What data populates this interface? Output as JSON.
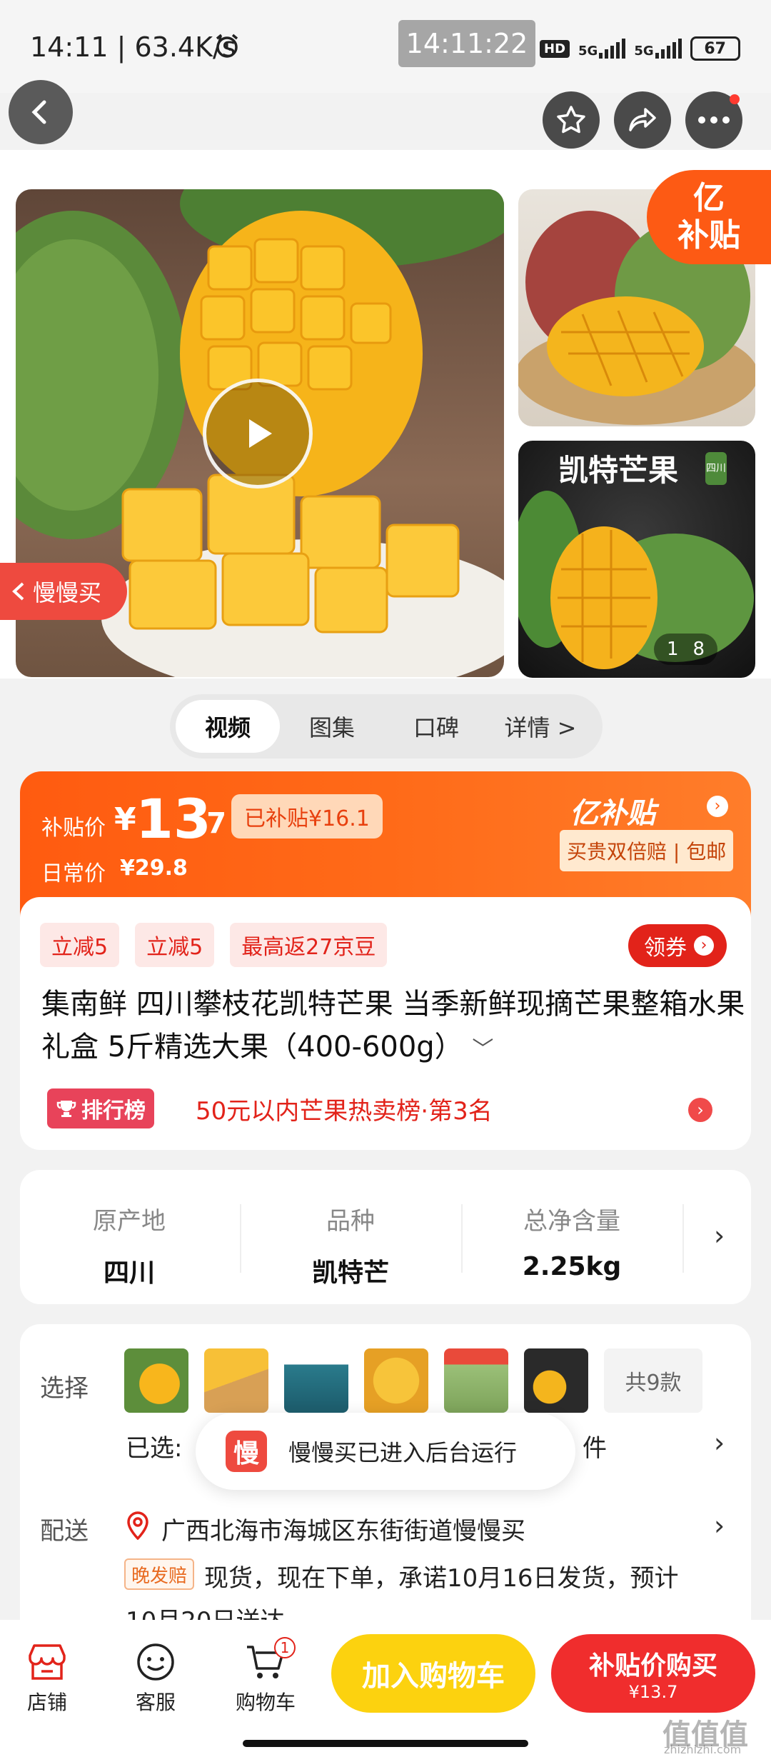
{
  "status_bar": {
    "left_text": "14:11 | 63.4K/s",
    "center_time": "14:11:22",
    "hd_label": "HD",
    "net1": "5G",
    "net2": "5G",
    "battery": "67"
  },
  "gallery": {
    "side_badge_line1": "亿",
    "side_badge_line2": "补贴",
    "kaite_title": "凯特芒果",
    "kaite_sub": "四川",
    "image_counter_current": "1",
    "image_counter_total": "8",
    "slow_buy_label": "慢慢买"
  },
  "tabs": [
    "视频",
    "图集",
    "口碑",
    "详情 >"
  ],
  "price": {
    "subsidy_label": "补贴价",
    "currency": "¥",
    "price_int": "13",
    "price_dec": ".7",
    "subsidized": "已补贴¥16.1",
    "daily_label": "日常价",
    "daily_price": "¥29.8",
    "brand": "亿补贴",
    "guarantee": "买贵双倍赔 | 包邮"
  },
  "promo": {
    "chips": [
      "立减5",
      "立减5",
      "最高返27京豆"
    ],
    "coupon_btn": "领券"
  },
  "title": {
    "text": "集南鲜  四川攀枝花凯特芒果 当季新鲜现摘芒果整箱水果礼盒 5斤精选大果（400-600g）"
  },
  "rank": {
    "badge": "排行榜",
    "text": "50元以内芒果热卖榜·第3名"
  },
  "specs": [
    {
      "k": "原产地",
      "v": "四川"
    },
    {
      "k": "品种",
      "v": "凯特芒"
    },
    {
      "k": "总净含量",
      "v": "2.25kg"
    }
  ],
  "choose": {
    "label": "选择",
    "count": "共9款",
    "selected_prefix": "已选:",
    "selected_suffix": "件"
  },
  "toast": {
    "icon_char": "慢",
    "text": "慢慢买已进入后台运行"
  },
  "delivery": {
    "label": "配送",
    "address": "广西北海市海城区东街街道慢慢买",
    "late_tag": "晚发赔",
    "line1": "现货，现在下单，承诺10月16日发货，预计",
    "line2": "10月20日送达"
  },
  "bottom_bar": {
    "shop": "店铺",
    "service": "客服",
    "cart": "购物车",
    "cart_badge": "1",
    "add_cart": "加入购物车",
    "buy": "补贴价购买",
    "buy_price": "¥13.7"
  },
  "watermark": "值值值",
  "watermark_url": "zhizhizhi.com"
}
